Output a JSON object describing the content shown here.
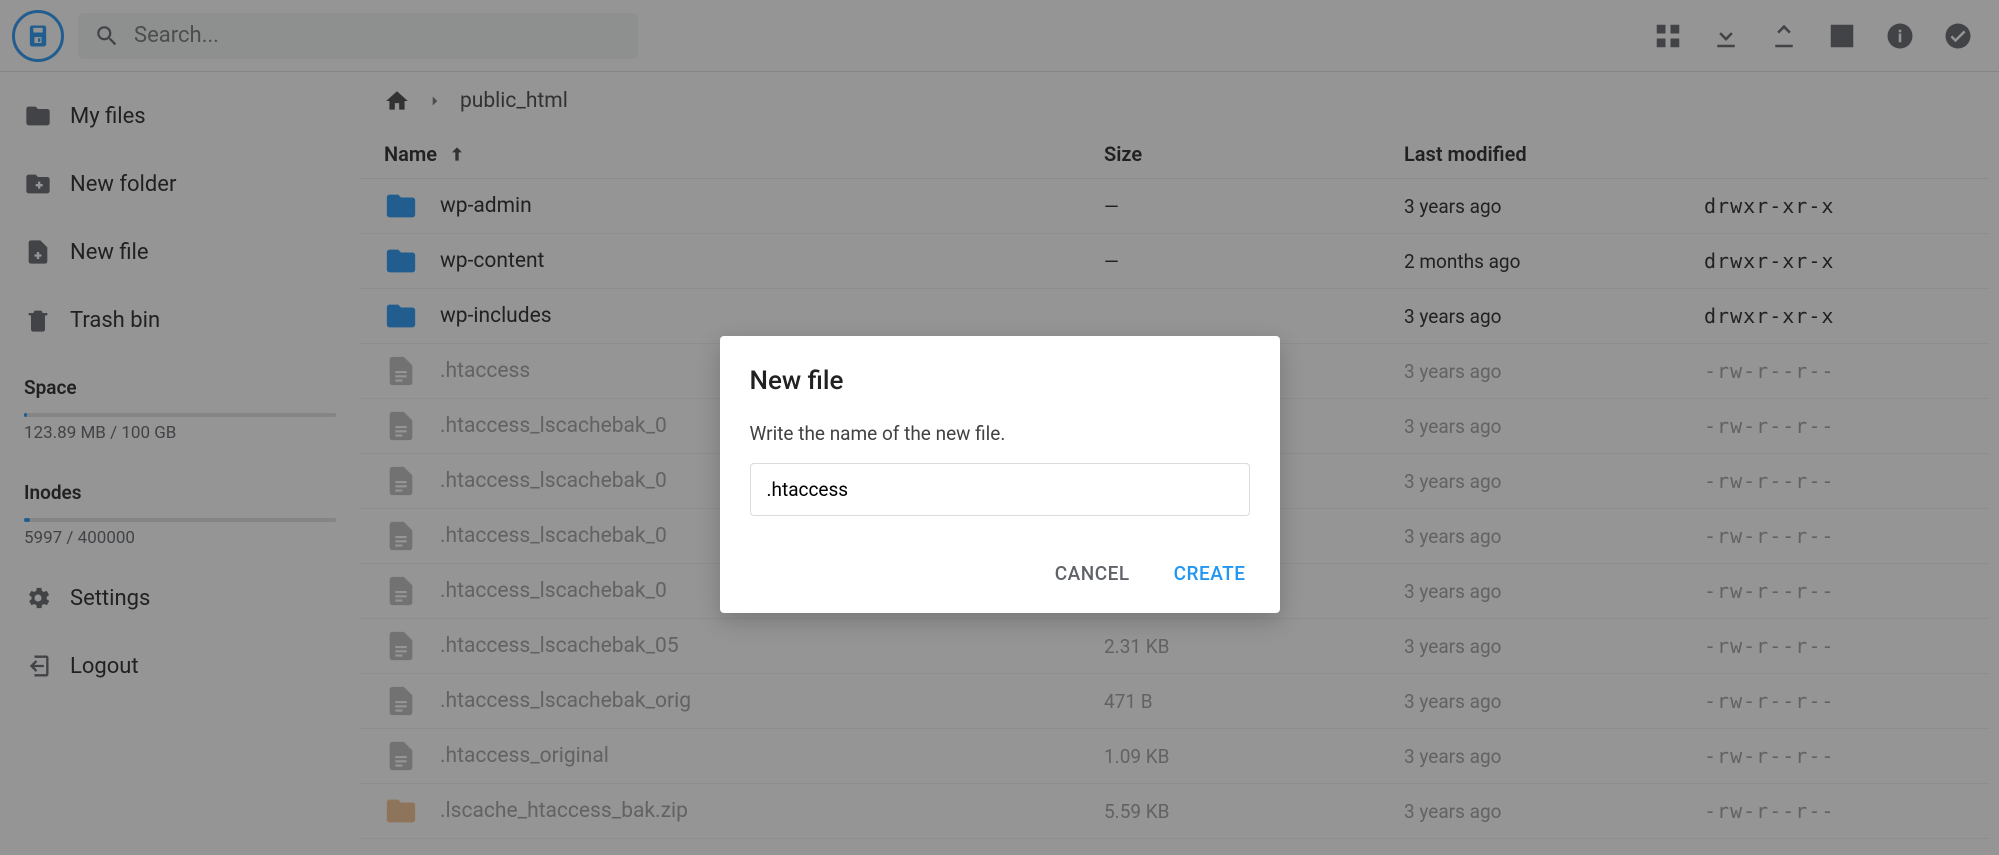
{
  "search": {
    "placeholder": "Search..."
  },
  "sidebar": {
    "items": [
      {
        "label": "My files"
      },
      {
        "label": "New folder"
      },
      {
        "label": "New file"
      },
      {
        "label": "Trash bin"
      }
    ],
    "space": {
      "title": "Space",
      "text": "123.89 MB / 100 GB",
      "pct": 1
    },
    "inodes": {
      "title": "Inodes",
      "text": "5997 / 400000",
      "pct": 2
    },
    "settings": "Settings",
    "logout": "Logout"
  },
  "breadcrumb": {
    "current": "public_html"
  },
  "table": {
    "headers": {
      "name": "Name",
      "size": "Size",
      "mod": "Last modified"
    },
    "rows": [
      {
        "type": "folder",
        "name": "wp-admin",
        "size": "—",
        "mod": "3 years ago",
        "perm": "drwxr-xr-x",
        "dim": false
      },
      {
        "type": "folder",
        "name": "wp-content",
        "size": "—",
        "mod": "2 months ago",
        "perm": "drwxr-xr-x",
        "dim": false
      },
      {
        "type": "folder",
        "name": "wp-includes",
        "size": "",
        "mod": "3 years ago",
        "perm": "drwxr-xr-x",
        "dim": false
      },
      {
        "type": "file",
        "name": ".htaccess",
        "size": "",
        "mod": "3 years ago",
        "perm": "-rw-r--r--",
        "dim": true
      },
      {
        "type": "file",
        "name": ".htaccess_lscachebak_0",
        "size": "",
        "mod": "3 years ago",
        "perm": "-rw-r--r--",
        "dim": true
      },
      {
        "type": "file",
        "name": ".htaccess_lscachebak_0",
        "size": "",
        "mod": "3 years ago",
        "perm": "-rw-r--r--",
        "dim": true
      },
      {
        "type": "file",
        "name": ".htaccess_lscachebak_0",
        "size": "",
        "mod": "3 years ago",
        "perm": "-rw-r--r--",
        "dim": true
      },
      {
        "type": "file",
        "name": ".htaccess_lscachebak_0",
        "size": "",
        "mod": "3 years ago",
        "perm": "-rw-r--r--",
        "dim": true
      },
      {
        "type": "file",
        "name": ".htaccess_lscachebak_05",
        "size": "2.31 KB",
        "mod": "3 years ago",
        "perm": "-rw-r--r--",
        "dim": true
      },
      {
        "type": "file",
        "name": ".htaccess_lscachebak_orig",
        "size": "471 B",
        "mod": "3 years ago",
        "perm": "-rw-r--r--",
        "dim": true
      },
      {
        "type": "file",
        "name": ".htaccess_original",
        "size": "1.09 KB",
        "mod": "3 years ago",
        "perm": "-rw-r--r--",
        "dim": true
      },
      {
        "type": "zip",
        "name": ".lscache_htaccess_bak.zip",
        "size": "5.59 KB",
        "mod": "3 years ago",
        "perm": "-rw-r--r--",
        "dim": true
      }
    ]
  },
  "dialog": {
    "title": "New file",
    "prompt": "Write the name of the new file.",
    "value": ".htaccess",
    "cancel": "CANCEL",
    "create": "CREATE"
  }
}
